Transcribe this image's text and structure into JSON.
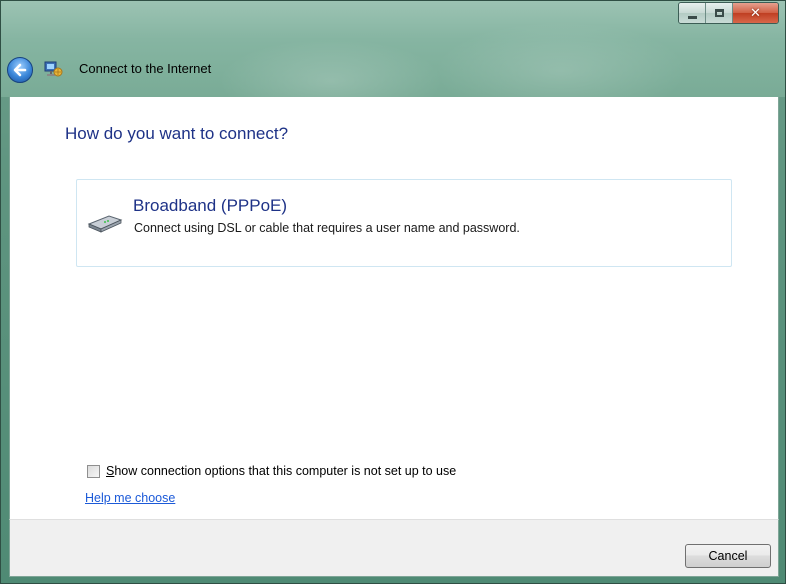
{
  "window": {
    "title": "Connect to the Internet",
    "controls": {
      "minimize": "minimize",
      "maximize": "maximize",
      "close": "close"
    }
  },
  "icons": {
    "back": "back-arrow-icon",
    "app": "network-connection-icon",
    "option": "broadband-modem-icon"
  },
  "main": {
    "heading": "How do you want to connect?",
    "options": [
      {
        "title": "Broadband (PPPoE)",
        "description": "Connect using DSL or cable that requires a user name and password."
      }
    ],
    "checkbox": {
      "accelerator": "S",
      "label_rest": "how connection options that this computer is not set up to use",
      "checked": false
    },
    "help_link": "Help me choose"
  },
  "footer": {
    "cancel_label": "Cancel"
  },
  "colors": {
    "heading": "#1e3287",
    "link": "#1c5ad8",
    "option_border": "#cfe6f2",
    "frame": "#79ab96"
  }
}
